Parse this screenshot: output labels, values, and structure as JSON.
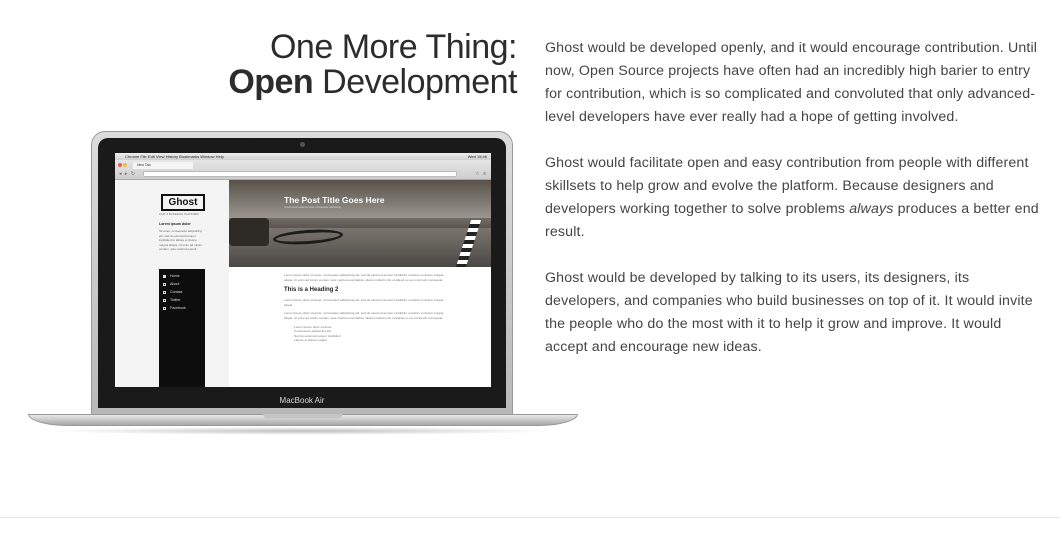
{
  "heading": {
    "line1": "One More Thing:",
    "line2_bold": "Open",
    "line2_rest": " Development"
  },
  "paragraphs": {
    "p1": "Ghost would be developed openly, and it would encourage contribution. Until now, Open Source projects have often had an incredibly high barier to entry for contribution, which is so complicated and convoluted that only advanced-level developers have ever really had a hope of getting involved.",
    "p2_before": "Ghost would facilitate open and easy contribution from people with different skillsets to help grow and evolve the platform. Because designers and developers working together to solve problems ",
    "p2_emph": "always",
    "p2_after": " produces a better end result.",
    "p3": "Ghost would be developed by talking to its users, its designers, its developers, and companies who build businesses on top of it. It would invite the people who do the most with it to help it grow and improve. It would accept and encourage new ideas."
  },
  "laptop": {
    "brand": "MacBook Air",
    "menubar": {
      "apple": "",
      "items": "Chrome   File   Edit   View   History   Bookmarks   Window   Help",
      "status": "Wed 15:46"
    },
    "browser": {
      "tab_label": "New Tab",
      "nav_glyphs": "◂ ▸ ↻",
      "tool_glyphs": "☆ ≡"
    },
    "site": {
      "logo": "Ghost",
      "tagline": "JUST A BLOGGING PLATFORM",
      "side_heading": "Lorem ipsum dolor",
      "side_text": "Sit amet, consectetur adipisicing elit, sed do eiusmod tempor incididunt ut labore et dolore magna aliqua. Ut enim ad minim veniam, quis nostrud exercit.",
      "nav": [
        "Home",
        "About",
        "Contact",
        "Twitter",
        "Facebook"
      ],
      "hero_title": "The Post Title Goes Here",
      "hero_meta": "Lorem ipsum dolor sit amet, consectetur adipisicing",
      "para1": "Lorem ipsum dolor sit amet, consectetur adipisicing elit, sed do eiusmod tempor incididunt ut labore et dolore magna aliqua. Ut enim ad minim veniam, quis nostrud exercitation ullamco laboris nisi ut aliquip ex ea commodo consequat.",
      "h2": "This is a Heading 2",
      "para2": "Lorem ipsum dolor sit amet, consectetur adipisicing elit, sed do eiusmod tempor incididunt ut labore et dolore magna aliqua.",
      "para3": "Lorem ipsum dolor sit amet, consectetur adipisicing elit, sed do eiusmod tempor incididunt ut labore et dolore magna aliqua. Ut enim ad minim veniam, quis nostrud exercitation ullamco laboris nisi ut aliquip ex ea commodo consequat.",
      "list": [
        "Lorem ipsum dolor sit amet",
        "Consectetur adipisicing elit",
        "Sed do eiusmod tempor incididunt",
        "Labore et dolore magna"
      ]
    }
  },
  "colors": {
    "text": "#444444",
    "heading": "#2c2c2c",
    "sidenav_bg": "#0d0d0d"
  }
}
